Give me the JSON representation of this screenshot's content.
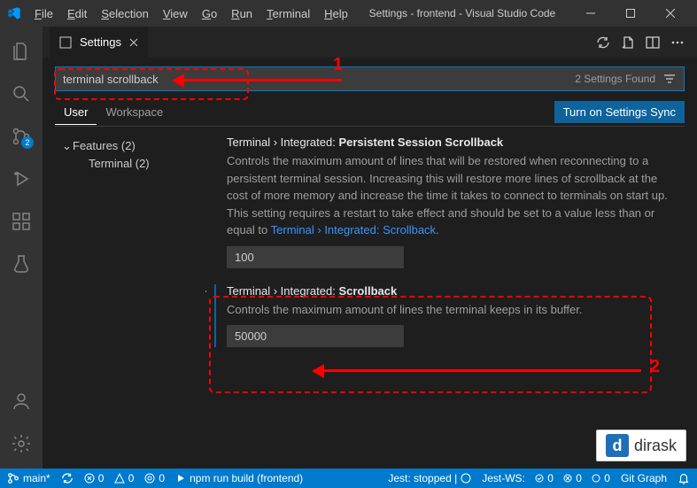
{
  "titlebar": {
    "menu": [
      "File",
      "Edit",
      "Selection",
      "View",
      "Go",
      "Run",
      "Terminal",
      "Help"
    ],
    "title": "Settings - frontend - Visual Studio Code"
  },
  "tab": {
    "label": "Settings"
  },
  "tab_actions": {
    "refresh": "refresh",
    "split": "split",
    "layout": "layout",
    "more": "more"
  },
  "search": {
    "value": "terminal scrollback",
    "results": "2 Settings Found"
  },
  "scopes": {
    "user": "User",
    "workspace": "Workspace",
    "sync": "Turn on Settings Sync"
  },
  "toc": {
    "features": "Features (2)",
    "terminal": "Terminal (2)"
  },
  "settings": [
    {
      "prefix": "Terminal › Integrated: ",
      "name": "Persistent Session Scrollback",
      "desc_a": "Controls the maximum amount of lines that will be restored when reconnecting to a persistent terminal session. Increasing this will restore more lines of scrollback at the cost of more memory and increase the time it takes to connect to terminals on start up. This setting requires a restart to take effect and should be set to a value less than or equal to ",
      "link": "Terminal › Integrated: Scrollback",
      "desc_b": ".",
      "value": "100"
    },
    {
      "prefix": "Terminal › Integrated: ",
      "name": "Scrollback",
      "desc_a": "Controls the maximum amount of lines the terminal keeps in its buffer.",
      "link": "",
      "desc_b": "",
      "value": "50000"
    }
  ],
  "statusbar": {
    "branch": "main*",
    "sync": "sync",
    "problems": "0",
    "warnings": "0",
    "ports": "0",
    "task": "npm run build (frontend)",
    "jest": "Jest: stopped | ",
    "jestws": "Jest-WS:",
    "jestws_pass": "0",
    "jestws_fail": "0",
    "jestws_skip": "0",
    "gitgraph": "Git Graph"
  },
  "source_control_badge": "2",
  "annotations": {
    "one": "1",
    "two": "2"
  },
  "dirask": {
    "label": "dirask",
    "logo": "d"
  }
}
